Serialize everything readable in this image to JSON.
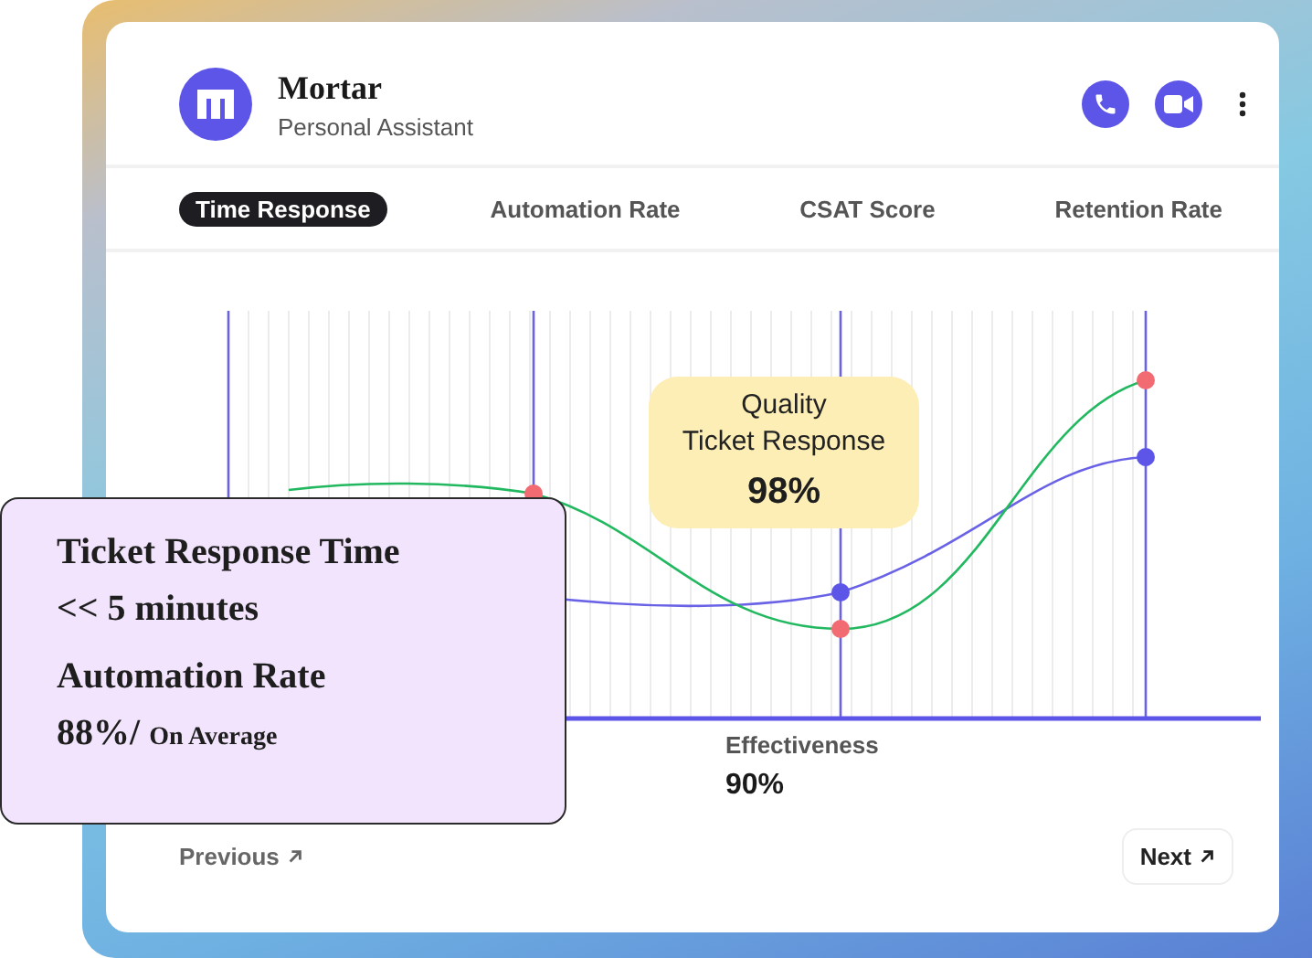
{
  "header": {
    "title": "Mortar",
    "subtitle": "Personal Assistant"
  },
  "tabs": [
    {
      "label": "Time Response",
      "selected": true
    },
    {
      "label": "Automation Rate",
      "selected": false
    },
    {
      "label": "CSAT Score",
      "selected": false
    },
    {
      "label": "Retention Rate",
      "selected": false
    }
  ],
  "tooltip": {
    "title": "Quality\nTicket Response",
    "value": "98%"
  },
  "stat": {
    "label": "Effectiveness",
    "value": "90%"
  },
  "summary_card": {
    "items": [
      {
        "label": "Ticket Response Time",
        "value": "<< 5 minutes"
      },
      {
        "label": "Automation Rate",
        "value": "88%/",
        "note": "On Average"
      }
    ]
  },
  "footer": {
    "previous": "Previous",
    "next": "Next"
  }
}
